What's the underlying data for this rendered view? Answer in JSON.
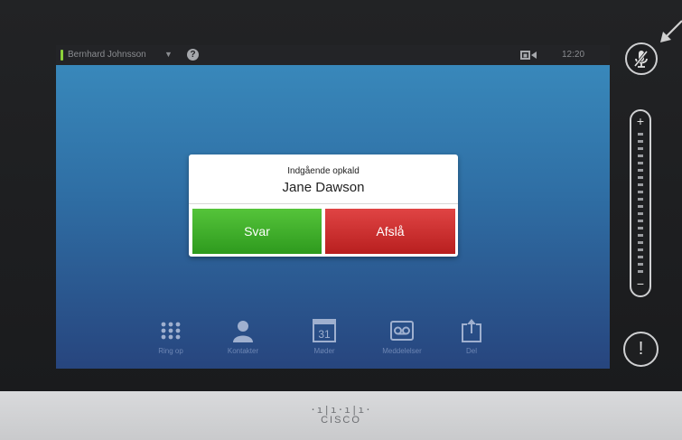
{
  "topbar": {
    "user_name": "Bernhard Johnsson",
    "caret": "▼",
    "help": "?",
    "time": "12:20",
    "camera_icon": "camera-icon"
  },
  "incoming_call": {
    "title": "Indgående opkald",
    "caller": "Jane Dawson",
    "accept_label": "Svar",
    "decline_label": "Afslå"
  },
  "dock": [
    {
      "label": "Ring op",
      "icon": "keypad-icon"
    },
    {
      "label": "Kontakter",
      "icon": "person-icon"
    },
    {
      "label": "Møder",
      "icon": "calendar-icon",
      "day": "31"
    },
    {
      "label": "Meddelelser",
      "icon": "voicemail-icon"
    },
    {
      "label": "Del",
      "icon": "share-icon"
    }
  ],
  "side": {
    "volume_plus": "+",
    "volume_minus": "−",
    "alert": "!"
  },
  "brand": {
    "bars": "·ı|ı·ı|ı·",
    "name": "CISCO"
  },
  "colors": {
    "accept": "#3aad27",
    "decline": "#cc2b2b",
    "presence": "#8bd13a"
  }
}
